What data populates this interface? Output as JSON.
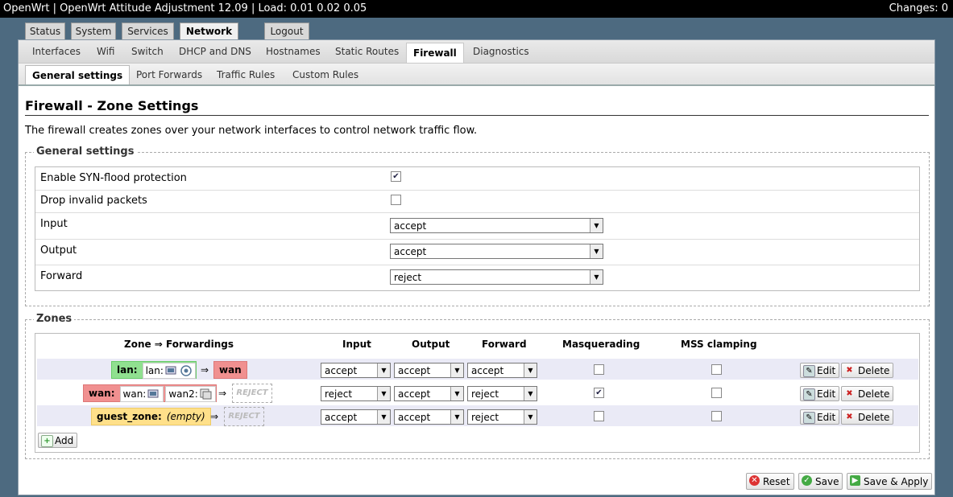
{
  "header": {
    "title": "OpenWrt | OpenWrt Attitude Adjustment 12.09 | Load: 0.01 0.02 0.05",
    "changes": "Changes: 0"
  },
  "main_tabs": [
    "Status",
    "System",
    "Services",
    "Network",
    "Logout"
  ],
  "sub_tabs": [
    "Interfaces",
    "Wifi",
    "Switch",
    "DHCP and DNS",
    "Hostnames",
    "Static Routes",
    "Firewall",
    "Diagnostics"
  ],
  "firewall_tabs": [
    "General settings",
    "Port Forwards",
    "Traffic Rules",
    "Custom Rules"
  ],
  "page": {
    "title": "Firewall - Zone Settings",
    "description": "The firewall creates zones over your network interfaces to control network traffic flow."
  },
  "general": {
    "legend": "General settings",
    "syn_label": "Enable SYN-flood protection",
    "syn_checked": true,
    "drop_label": "Drop invalid packets",
    "drop_checked": false,
    "input_label": "Input",
    "input_value": "accept",
    "output_label": "Output",
    "output_value": "accept",
    "forward_label": "Forward",
    "forward_value": "reject"
  },
  "zones": {
    "legend": "Zones",
    "headers": {
      "zone": "Zone ⇒ Forwardings",
      "input": "Input",
      "output": "Output",
      "forward": "Forward",
      "masq": "Masquerading",
      "mss": "MSS clamping"
    },
    "rows": [
      {
        "name": "lan:",
        "iface1": "lan:",
        "iface2": "",
        "target": "wan",
        "input": "accept",
        "output": "accept",
        "forward": "accept",
        "masq": false,
        "mss": false
      },
      {
        "name": "wan:",
        "iface1": "wan:",
        "iface2": "wan2:",
        "target": "REJECT",
        "input": "reject",
        "output": "accept",
        "forward": "reject",
        "masq": true,
        "mss": false
      },
      {
        "name": "guest_zone:",
        "iface1": "(empty)",
        "iface2": "",
        "target": "REJECT",
        "input": "accept",
        "output": "accept",
        "forward": "reject",
        "masq": false,
        "mss": false
      }
    ],
    "arrow": "⇒",
    "edit_label": "Edit",
    "delete_label": "Delete",
    "add_label": "Add"
  },
  "footer": {
    "reset": "Reset",
    "save": "Save",
    "save_apply": "Save & Apply"
  },
  "colors": {
    "lan": "#90e090",
    "wan": "#f09090",
    "guest": "#ffe08a"
  }
}
